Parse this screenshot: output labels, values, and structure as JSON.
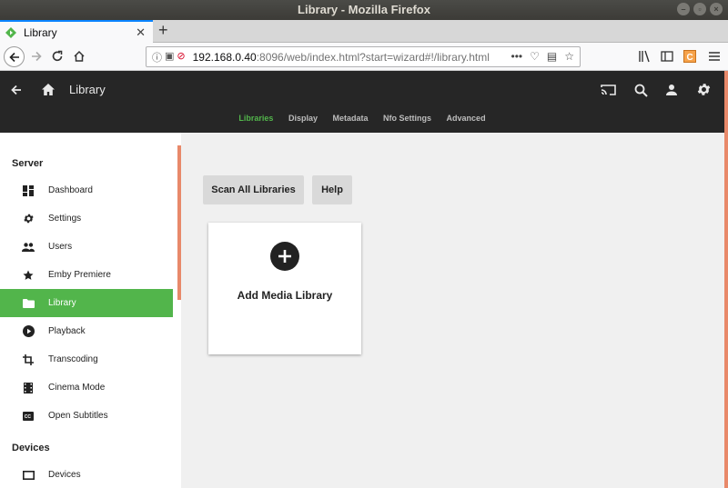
{
  "window": {
    "title": "Library - Mozilla Firefox"
  },
  "browser": {
    "tab_title": "Library",
    "url_host": "192.168.0.40",
    "url_rest": ":8096/web/index.html?start=wizard#!/library.html",
    "url_more": "•••"
  },
  "header": {
    "title": "Library",
    "tabs": [
      {
        "label": "Libraries",
        "active": true
      },
      {
        "label": "Display"
      },
      {
        "label": "Metadata"
      },
      {
        "label": "Nfo Settings"
      },
      {
        "label": "Advanced"
      }
    ]
  },
  "sidebar": {
    "server_header": "Server",
    "items": [
      {
        "label": "Dashboard",
        "icon": "dashboard-icon"
      },
      {
        "label": "Settings",
        "icon": "gear-icon"
      },
      {
        "label": "Users",
        "icon": "users-icon"
      },
      {
        "label": "Emby Premiere",
        "icon": "star-icon"
      },
      {
        "label": "Library",
        "icon": "folder-icon",
        "active": true
      },
      {
        "label": "Playback",
        "icon": "play-circle-icon"
      },
      {
        "label": "Transcoding",
        "icon": "crop-icon"
      },
      {
        "label": "Cinema Mode",
        "icon": "film-icon"
      },
      {
        "label": "Open Subtitles",
        "icon": "closed-captions-icon"
      }
    ],
    "devices_header": "Devices",
    "device_items": [
      {
        "label": "Devices",
        "icon": "device-icon"
      }
    ]
  },
  "main": {
    "scan_button": "Scan All Libraries",
    "help_button": "Help",
    "add_library_label": "Add Media Library"
  },
  "colors": {
    "accent": "#52b54b",
    "header_bg": "#262626",
    "scroll_accent": "#e8896a"
  }
}
